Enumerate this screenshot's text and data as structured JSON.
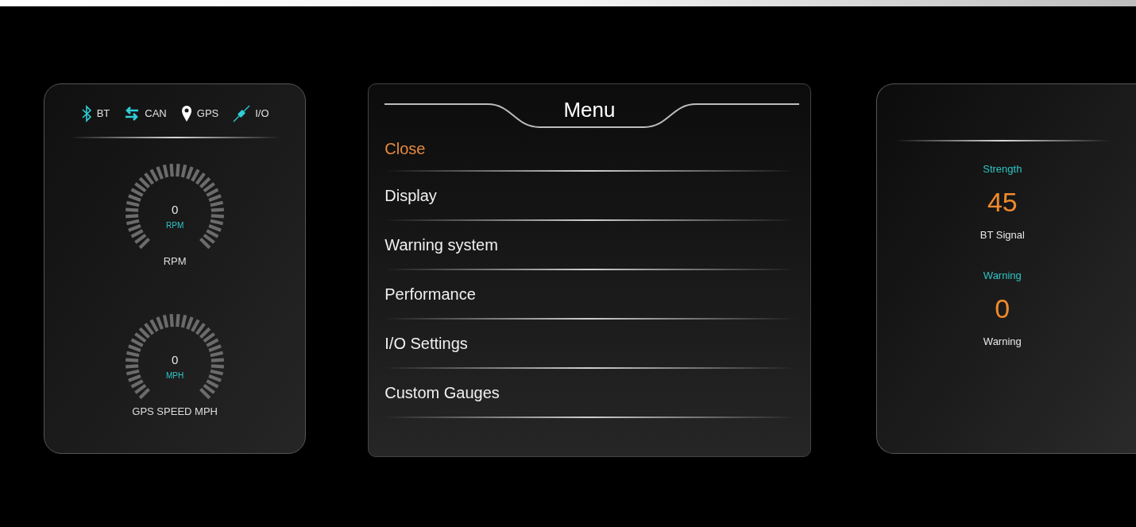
{
  "status_indicators": [
    {
      "kind": "bluetooth",
      "label": "BT",
      "active": true
    },
    {
      "kind": "can",
      "label": "CAN",
      "active": true
    },
    {
      "kind": "gps",
      "label": "GPS",
      "active": false
    },
    {
      "kind": "io",
      "label": "I/O",
      "active": true
    }
  ],
  "gauges": [
    {
      "value": "0",
      "unit": "RPM",
      "label": "RPM"
    },
    {
      "value": "0",
      "unit": "MPH",
      "label": "GPS SPEED MPH"
    }
  ],
  "menu": {
    "title": "Menu",
    "items": [
      {
        "label": "Close",
        "selected": true
      },
      {
        "label": "Display",
        "selected": false
      },
      {
        "label": "Warning system",
        "selected": false
      },
      {
        "label": "Performance",
        "selected": false
      },
      {
        "label": "I/O Settings",
        "selected": false
      },
      {
        "label": "Custom Gauges",
        "selected": false
      }
    ]
  },
  "readouts": [
    {
      "heading": "Strength",
      "value": "45",
      "label": "BT Signal"
    },
    {
      "heading": "Warning",
      "value": "0",
      "label": "Warning"
    }
  ]
}
